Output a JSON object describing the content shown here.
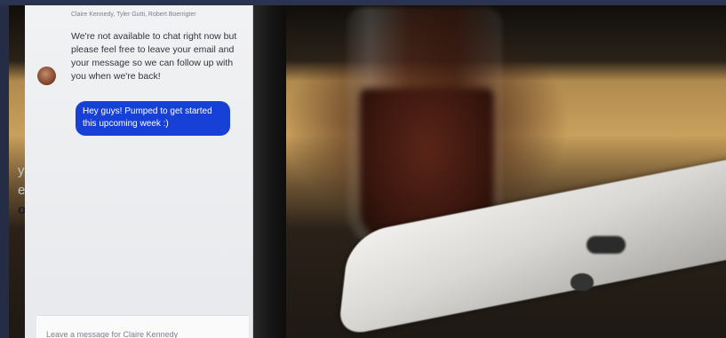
{
  "chat": {
    "participants": "Claire Kennedy, Tyler Gutti, Robert Boerrigter",
    "agent_message": "We're not available to chat right now but please feel free to leave your email and your message so we can follow up with you when we're back!",
    "user_message": "Hey guys! Pumped to get started this upcoming week :)",
    "composer_placeholder": "Leave a message for Claire Kennedy"
  },
  "background_fragments": [
    "yo",
    "eo",
    "o"
  ],
  "colors": {
    "user_bubble": "#1740d6",
    "chat_panel": "#f1f2f4",
    "frame": "#20263a"
  }
}
